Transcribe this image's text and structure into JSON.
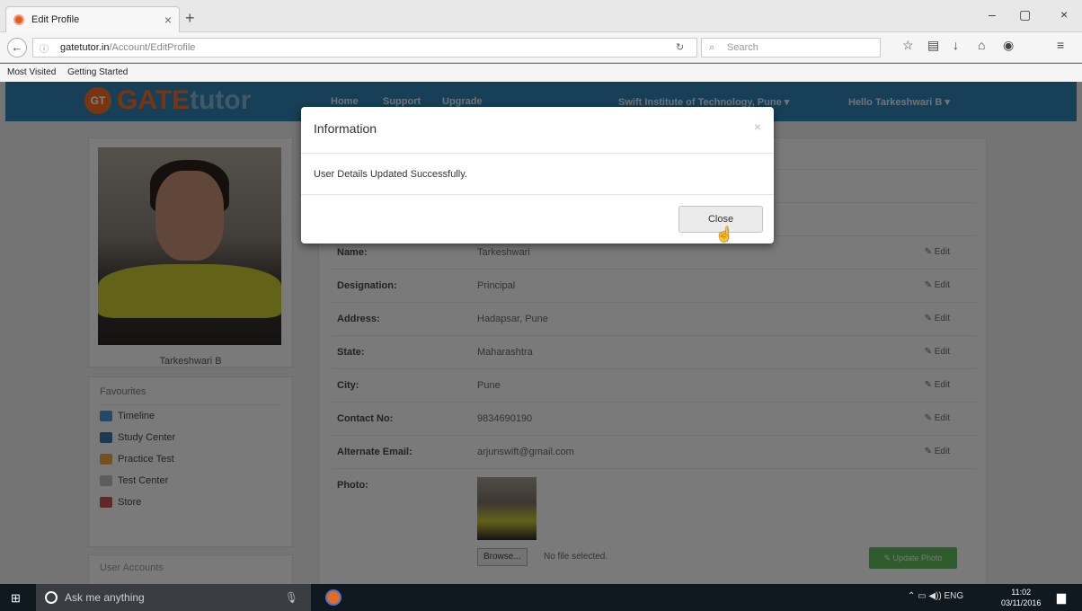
{
  "browser": {
    "tab_title": "Edit Profile",
    "tab_close": "×",
    "new_tab": "+",
    "url_host": "gatetutor.in",
    "url_path": "/Account/EditProfile",
    "search_placeholder": "Search",
    "bookmarks": [
      "Most Visited",
      "Getting Started"
    ],
    "win_min": "–",
    "win_max": "▢",
    "win_close": "×"
  },
  "site": {
    "logo_badge": "GT",
    "logo_word1": "GATE",
    "logo_word2": "tutor",
    "nav": [
      "Home",
      "Support",
      "Upgrade"
    ],
    "institute": "Swift Institute of Technology, Pune ▾",
    "greeting": "Hello Tarkeshwari B ▾"
  },
  "profile": {
    "name": "Tarkeshwari B",
    "favourites_title": "Favourites",
    "favourites": [
      "Timeline",
      "Study Center",
      "Practice Test",
      "Test Center",
      "Store"
    ],
    "user_accounts_title": "User Accounts"
  },
  "details": {
    "rows": [
      {
        "label": "Name:",
        "value": "Tarkeshwari",
        "edit": "✎ Edit"
      },
      {
        "label": "Designation:",
        "value": "Principal",
        "edit": "✎ Edit"
      },
      {
        "label": "Address:",
        "value": "Hadapsar, Pune",
        "edit": "✎ Edit"
      },
      {
        "label": "State:",
        "value": "Maharashtra",
        "edit": "✎ Edit"
      },
      {
        "label": "City:",
        "value": "Pune",
        "edit": "✎ Edit"
      },
      {
        "label": "Contact No:",
        "value": "9834690190",
        "edit": "✎ Edit"
      },
      {
        "label": "Alternate Email:",
        "value": "arjunswift@gmail.com",
        "edit": "✎ Edit"
      }
    ],
    "photo_label": "Photo:",
    "browse_label": "Browse...",
    "no_file": "No file selected.",
    "update_photo": "✎ Update Photo"
  },
  "modal": {
    "title": "Information",
    "close_x": "×",
    "message": "User Details Updated Successfully.",
    "close_button": "Close"
  },
  "taskbar": {
    "search_placeholder": "Ask me anything",
    "lang": "ENG",
    "time": "11:02",
    "date": "03/11/2016"
  }
}
